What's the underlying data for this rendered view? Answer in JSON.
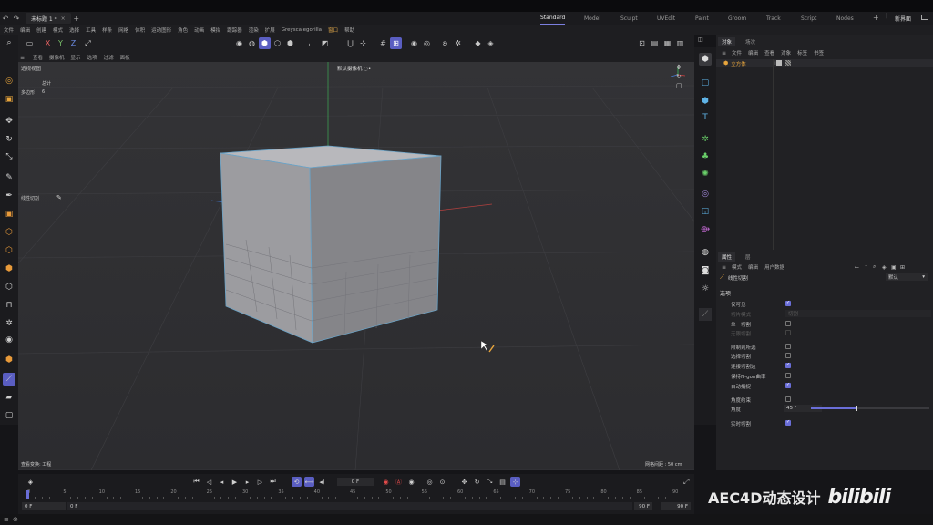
{
  "titlebar": {
    "doc_tab": "未标题 1 *",
    "add_tab": "+",
    "workspaces": [
      "Standard",
      "Model",
      "Sculpt",
      "UVEdit",
      "Paint",
      "Groom",
      "Track",
      "Script",
      "Nodes"
    ],
    "active_workspace": "Standard",
    "new_ui": "新界面"
  },
  "menubar": {
    "items": [
      "文件",
      "编辑",
      "创建",
      "模式",
      "选择",
      "工具",
      "样条",
      "网格",
      "体积",
      "运动图形",
      "角色",
      "动画",
      "模拟",
      "跟踪器",
      "渲染",
      "扩展",
      "Greyscalegorilla",
      "窗口",
      "帮助"
    ],
    "highlighted": [
      "窗口"
    ]
  },
  "toolbar": {
    "axes": [
      "X",
      "Y",
      "Z"
    ]
  },
  "viewport_menu": [
    "查看",
    "摄像机",
    "显示",
    "选项",
    "过滤",
    "面板"
  ],
  "viewport": {
    "name": "透视视图",
    "camera": "默认摄像机 ◌•",
    "stats_label": "总计",
    "polygons_label": "多边形",
    "polygons_value": "6",
    "tool_label": "线性切割",
    "view_transform": "查看变换: 工程",
    "grid_spacing": "网格间距 : 50 cm"
  },
  "object_panel": {
    "tabs": [
      "对象",
      "场次"
    ],
    "menu": [
      "文件",
      "编辑",
      "查看",
      "对象",
      "标签",
      "书签"
    ],
    "object_name": "立方体"
  },
  "attr_panel": {
    "tabs": [
      "属性",
      "层"
    ],
    "menu": [
      "模式",
      "编辑",
      "用户数据"
    ],
    "tool_name": "线性切割",
    "preset": "默认",
    "section": "选项",
    "rows": [
      {
        "label": "仅可见",
        "checked": true,
        "dim": false
      },
      {
        "label": "切片模式",
        "checked": null,
        "dim": true,
        "value": "切割"
      },
      {
        "label": "单一切割",
        "checked": false,
        "dim": false
      },
      {
        "label": "无限切割",
        "checked": null,
        "dim": true
      },
      {
        "label": "限制到所选",
        "checked": false,
        "dim": false
      },
      {
        "label": "选择切割",
        "checked": false,
        "dim": false
      },
      {
        "label": "连接切割边",
        "checked": true,
        "dim": false
      },
      {
        "label": "保持N-gon曲率",
        "checked": false,
        "dim": false
      },
      {
        "label": "自动捕捉",
        "checked": true,
        "dim": false
      },
      {
        "label": "角度约束",
        "checked": false,
        "dim": false
      },
      {
        "label": "角度",
        "checked": null,
        "dim": false,
        "value": "45 °"
      },
      {
        "label": "实时切割",
        "checked": true,
        "dim": false
      }
    ],
    "angle_fraction": 0.38
  },
  "timeline": {
    "current_frame": "0 F",
    "ticks": [
      "0",
      "5",
      "10",
      "15",
      "20",
      "25",
      "30",
      "35",
      "40",
      "45",
      "50",
      "55",
      "60",
      "65",
      "70",
      "75",
      "80",
      "85",
      "90"
    ],
    "start": "0 F",
    "start2": "0 F",
    "end": "90 F",
    "end2": "90 F"
  },
  "watermark": {
    "text": "AEC4D动态设计",
    "logo": "bilibili"
  }
}
